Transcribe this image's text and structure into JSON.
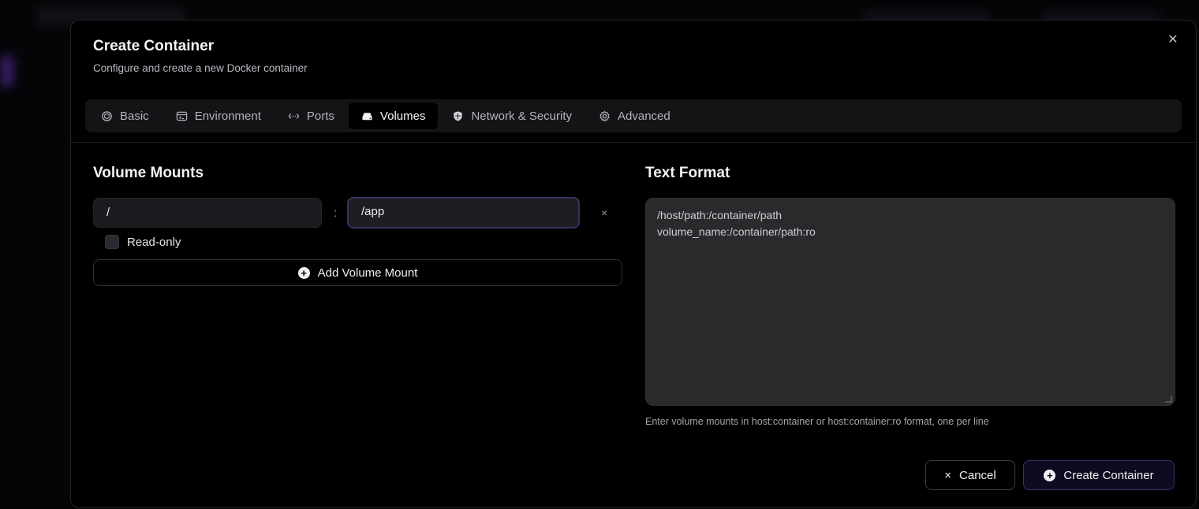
{
  "dialog": {
    "title": "Create Container",
    "subtitle": "Configure and create a new Docker container",
    "close_icon": "close-icon"
  },
  "tabs": [
    {
      "label": "Basic",
      "icon": "cube-icon",
      "active": false
    },
    {
      "label": "Environment",
      "icon": "terminal-box-icon",
      "active": false
    },
    {
      "label": "Ports",
      "icon": "arrows-horizontal-icon",
      "active": false
    },
    {
      "label": "Volumes",
      "icon": "hard-drive-icon",
      "active": true
    },
    {
      "label": "Network & Security",
      "icon": "shield-icon",
      "active": false
    },
    {
      "label": "Advanced",
      "icon": "gear-icon",
      "active": false
    }
  ],
  "volume_mounts": {
    "title": "Volume Mounts",
    "mounts": [
      {
        "host_path": "/",
        "container_path": "/app",
        "read_only": false
      }
    ],
    "read_only_label": "Read-only",
    "separator": ":",
    "remove_symbol": "×",
    "add_label": "Add Volume Mount"
  },
  "text_format": {
    "title": "Text Format",
    "lines": [
      "/host/path:/container/path",
      "volume_name:/container/path:ro"
    ],
    "helper": "Enter volume mounts in host:container or host:container:ro format, one per line"
  },
  "footer": {
    "cancel_label": "Cancel",
    "cancel_symbol": "×",
    "create_label": "Create Container",
    "create_symbol": "+"
  },
  "colors": {
    "dialog_bg": "#000000",
    "tab_bar_bg": "#141417",
    "field_bg": "#1b1b1f",
    "accent_border": "#3b2f6b"
  }
}
